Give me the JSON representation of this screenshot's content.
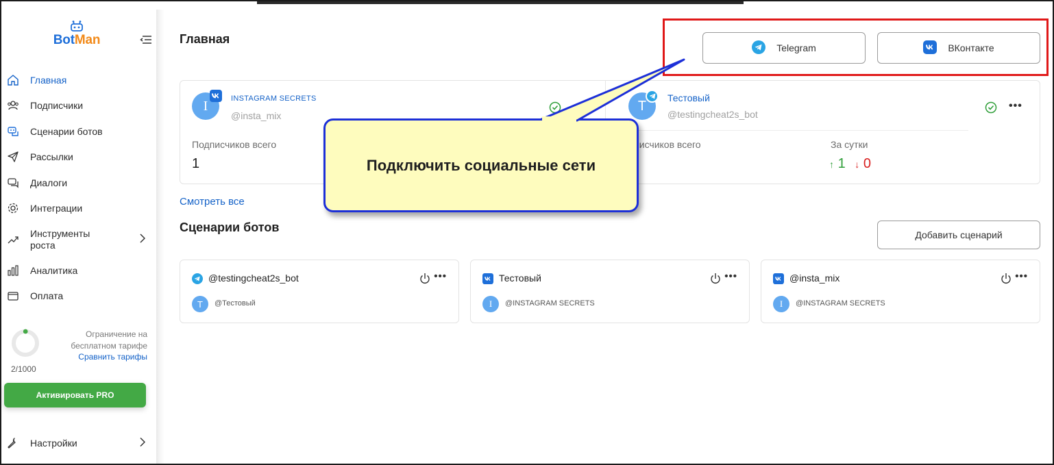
{
  "app": {
    "logo_text_part1": "Bot",
    "logo_text_part2": "Man",
    "brand_colors": {
      "blue": "#1e6fd9",
      "orange": "#f28a1a"
    }
  },
  "sidebar": {
    "items": [
      {
        "label": "Главная",
        "icon": "home-icon",
        "active": true
      },
      {
        "label": "Подписчики",
        "icon": "users-icon"
      },
      {
        "label": "Сценарии ботов",
        "icon": "bot-scenarios-icon"
      },
      {
        "label": "Рассылки",
        "icon": "send-icon"
      },
      {
        "label": "Диалоги",
        "icon": "chat-icon"
      },
      {
        "label": "Интеграции",
        "icon": "integrations-icon"
      },
      {
        "label": "Инструменты роста",
        "icon": "growth-icon",
        "has_submenu": true
      },
      {
        "label": "Аналитика",
        "icon": "analytics-icon"
      },
      {
        "label": "Оплата",
        "icon": "wallet-icon"
      }
    ],
    "limit": {
      "used": 2,
      "total": 1000,
      "count_text": "2/1000",
      "text": "Ограничение на бесплатном тарифе",
      "compare_link": "Сравнить тарифы"
    },
    "pro_button": "Активировать PRO",
    "settings_label": "Настройки"
  },
  "header": {
    "title": "Главная",
    "telegram_button": "Telegram",
    "vk_button": "ВКонтакте"
  },
  "accounts": [
    {
      "name": "INSTAGRAM SECRETS",
      "handle": "@insta_mix",
      "network": "vk",
      "avatar_letter": "I",
      "subscribers_label": "Подписчиков всего",
      "subscribers": "1"
    },
    {
      "name": "Тестовый",
      "handle": "@testingcheat2s_bot",
      "network": "telegram",
      "avatar_letter": "T",
      "subscribers_label": "дписчиков всего",
      "day_label": "За сутки",
      "day_up": "1",
      "day_down": "0"
    }
  ],
  "see_all": "Смотреть все",
  "scenarios": {
    "title": "Сценарии ботов",
    "add_button": "Добавить сценарий",
    "cards": [
      {
        "name": "@testingcheat2s_bot",
        "network": "telegram",
        "account": "@Тестовый",
        "avatar_letter": "T"
      },
      {
        "name": "Тестовый",
        "network": "vk",
        "account": "@INSTAGRAM SECRETS",
        "avatar_letter": "I"
      },
      {
        "name": "@insta_mix",
        "network": "vk",
        "account": "@INSTAGRAM SECRETS",
        "avatar_letter": "I"
      }
    ]
  },
  "callout": {
    "text": "Подключить социальные сети",
    "colors": {
      "fill": "#fefcbe",
      "border": "#1c2fd8",
      "highlight_box": "#e01818"
    }
  },
  "status_colors": {
    "up": "#2e9e38",
    "down": "#d92020",
    "active": "#2e9e38"
  }
}
